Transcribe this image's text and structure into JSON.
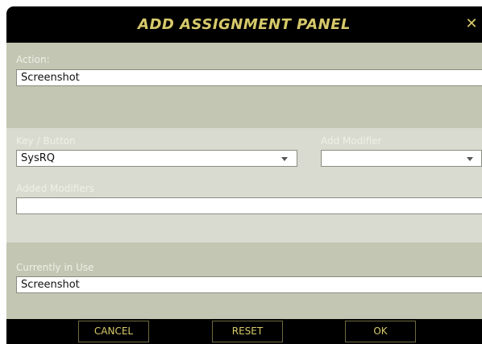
{
  "dialog": {
    "title": "ADD ASSIGNMENT PANEL",
    "close_glyph": "✕"
  },
  "action": {
    "label": "Action:",
    "value": "Screenshot"
  },
  "key_button": {
    "label": "Key / Button",
    "value": "SysRQ"
  },
  "add_modifier": {
    "label": "Add Modifier",
    "value": ""
  },
  "added_modifiers": {
    "label": "Added Modifiers",
    "value": ""
  },
  "currently_in_use": {
    "label": "Currently in Use",
    "value": "Screenshot"
  },
  "buttons": {
    "cancel": "CANCEL",
    "reset": "RESET",
    "ok": "OK"
  },
  "colors": {
    "accent_gold": "#d6c96a",
    "panel_olive": "#c2c6b2",
    "panel_light": "#dadbd0",
    "titlebar": "#000000"
  }
}
